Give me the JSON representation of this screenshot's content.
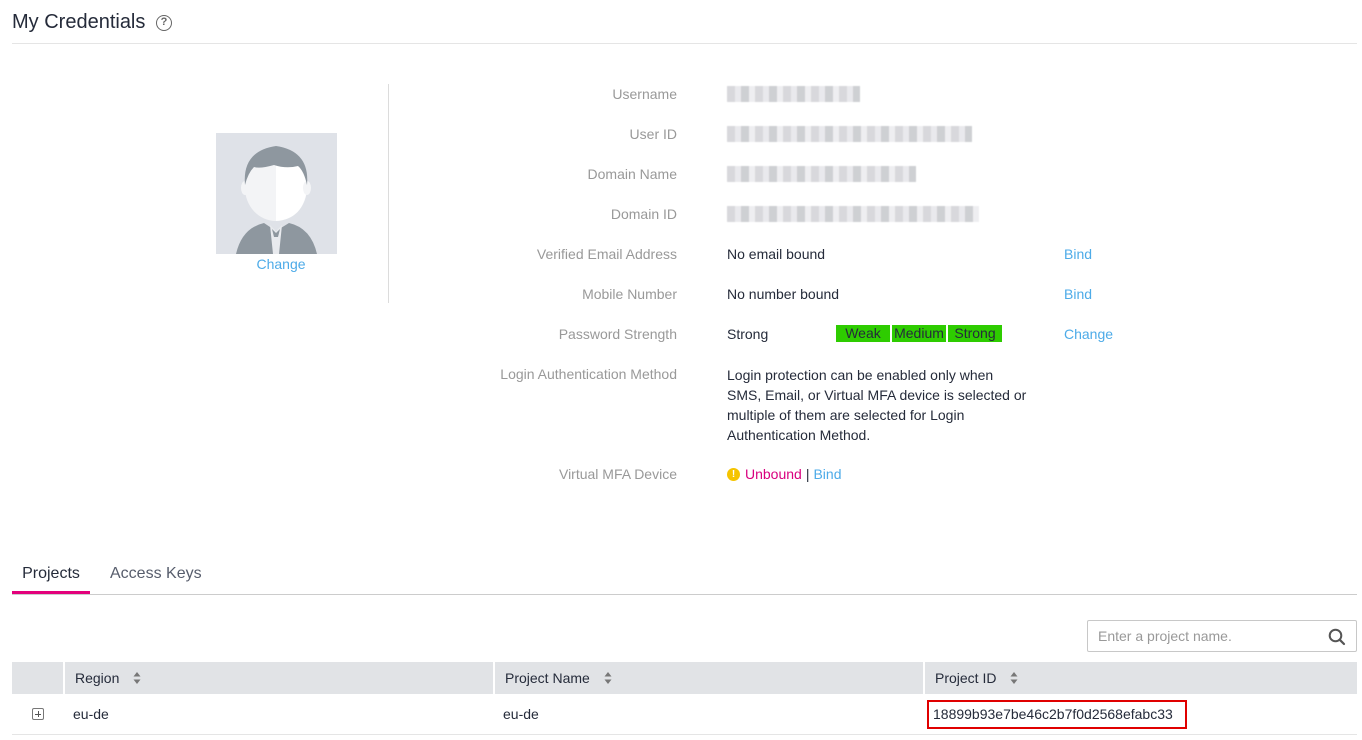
{
  "header": {
    "title": "My Credentials",
    "help_icon": "question-circle-icon"
  },
  "avatar": {
    "change_label": "Change"
  },
  "info": {
    "username_label": "Username",
    "user_id_label": "User ID",
    "domain_name_label": "Domain Name",
    "domain_id_label": "Domain ID",
    "email_label": "Verified Email Address",
    "email_value": "No email bound",
    "email_action": "Bind",
    "mobile_label": "Mobile Number",
    "mobile_value": "No number bound",
    "mobile_action": "Bind",
    "password_label": "Password Strength",
    "password_value": "Strong",
    "password_levels": [
      "Weak",
      "Medium",
      "Strong"
    ],
    "password_action": "Change",
    "login_label": "Login Authentication Method",
    "login_value": "Login protection can be enabled only when SMS, Email, or Virtual MFA device is selected or multiple of them are selected for Login Authentication Method.",
    "mfa_label": "Virtual MFA Device",
    "mfa_status": "Unbound",
    "mfa_separator": "|",
    "mfa_action": "Bind"
  },
  "tabs": [
    {
      "label": "Projects",
      "active": true
    },
    {
      "label": "Access Keys",
      "active": false
    }
  ],
  "search": {
    "placeholder": "Enter a project name.",
    "value": ""
  },
  "table": {
    "columns": [
      "Region",
      "Project Name",
      "Project ID"
    ],
    "rows": [
      {
        "region": "eu-de",
        "project_name": "eu-de",
        "project_id": "18899b93e7be46c2b7f0d2568efabc33"
      }
    ]
  },
  "colors": {
    "accent": "#e3007b",
    "link": "#4dabe8",
    "strength": "#2ecc00",
    "unbound": "#d9007f",
    "highlight": "#e00000"
  }
}
